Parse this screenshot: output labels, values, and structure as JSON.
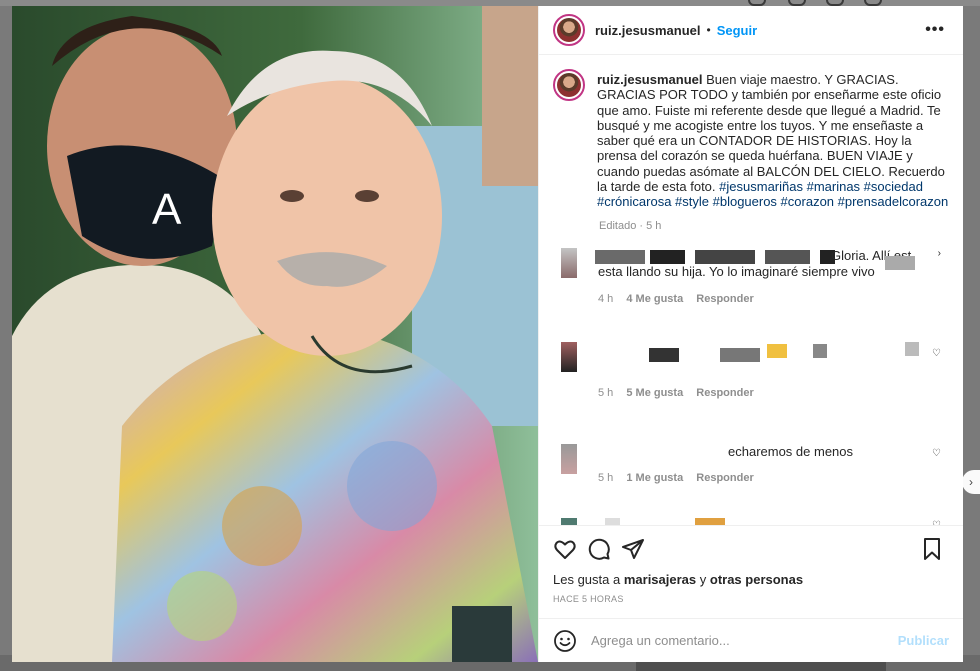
{
  "post": {
    "username": "ruiz.jesusmanuel",
    "separator": "•",
    "follow_label": "Seguir",
    "more_label": "•••",
    "caption_text": "Buen viaje maestro. Y GRACIAS. GRACIAS POR TODO y también por enseñarme este oficio que amo. Fuiste mi referente desde que llegué a Madrid. Te busqué y me acogiste entre los tuyos. Y me enseñaste a saber qué era un CONTADOR DE HISTORIAS. Hoy la prensa del corazón se queda huérfana. BUEN VIAJE y cuando puedas asómate al BALCÓN DEL CIELO. Recuerdo la tarde de esta foto.",
    "hashtags": "#jesusmariñas #marinas #sociedad #crónicarosa #style #blogueros #corazon #prensadelcorazon",
    "edited_label": "Editado · 5 h"
  },
  "comments": [
    {
      "text_visible": "Gloria. Allí est",
      "text_line2": "esta llando su hija. Yo lo imaginaré siempre vivo",
      "time": "4 h",
      "likes": "4 Me gusta",
      "reply": "Responder"
    },
    {
      "text_visible": "",
      "time": "5 h",
      "likes": "5 Me gusta",
      "reply": "Responder"
    },
    {
      "text_visible": "echaremos de menos",
      "time": "5 h",
      "likes": "1 Me gusta",
      "reply": "Responder"
    },
    {
      "text_visible": ""
    }
  ],
  "actions": {
    "likes_prefix": "Les gusta a",
    "liker": "marisajeras",
    "and_word": "y",
    "others": "otras personas",
    "time_ago": "HACE 5 HORAS"
  },
  "add_comment": {
    "placeholder": "Agrega un comentario...",
    "publish_label": "Publicar"
  },
  "icons": {
    "like": "heart-icon",
    "comment": "comment-icon",
    "share": "share-icon",
    "save": "bookmark-icon",
    "emoji": "emoji-icon",
    "more": "more-icon"
  },
  "colors": {
    "link_blue": "#0095f6",
    "hashtag": "#00376b",
    "muted": "#8e8e8e",
    "publish_disabled": "#b2dffc"
  }
}
